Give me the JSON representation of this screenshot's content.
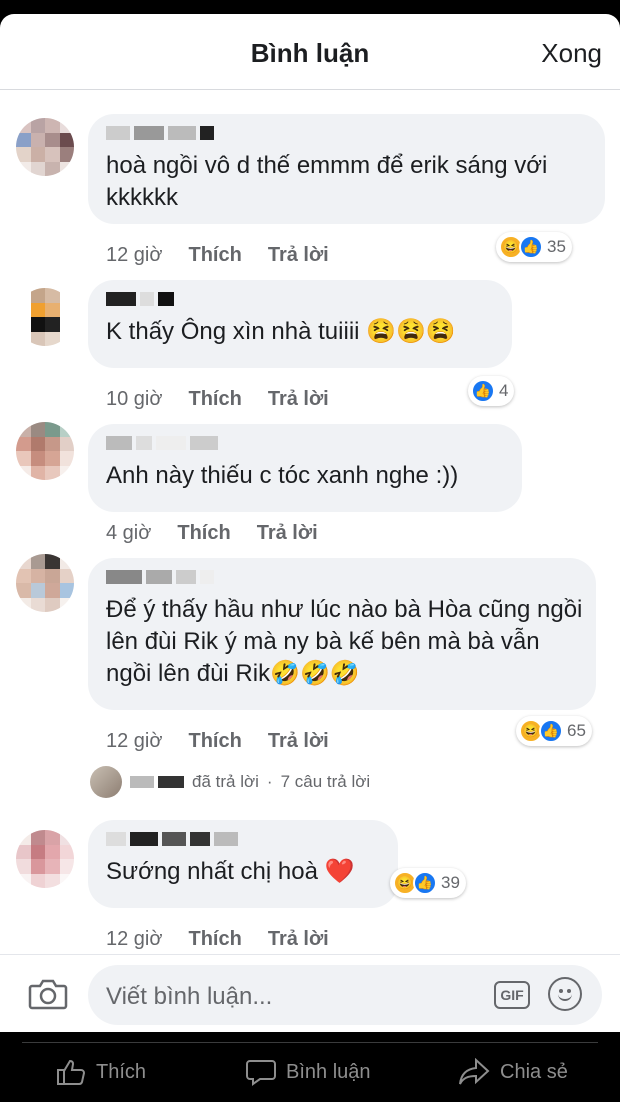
{
  "header": {
    "title": "Bình luận",
    "done_label": "Xong"
  },
  "comments": [
    {
      "text": "hoà ngồi vô d thế emmm để erik sáng với kkkkkk",
      "time": "12 giờ",
      "like_label": "Thích",
      "reply_label": "Trả lời",
      "reaction_count": "35"
    },
    {
      "text": "K thấy Ông xìn nhà tuiiii 😫😫😫",
      "time": "10 giờ",
      "like_label": "Thích",
      "reply_label": "Trả lời",
      "reaction_count": "4"
    },
    {
      "text": "Anh này thiếu c tóc xanh nghe :))",
      "time": "4 giờ",
      "like_label": "Thích",
      "reply_label": "Trả lời"
    },
    {
      "text": "Để ý thấy hầu như lúc nào bà Hòa cũng ngồi lên đùi Rik ý mà ny bà kế bên mà bà vẫn ngồi lên đùi Rik🤣🤣🤣",
      "time": "12 giờ",
      "like_label": "Thích",
      "reply_label": "Trả lời",
      "reaction_count": "65"
    },
    {
      "text": "Sướng nhất chị hoà ❤️",
      "time": "12 giờ",
      "like_label": "Thích",
      "reply_label": "Trả lời",
      "reaction_count": "39"
    }
  ],
  "reply_summary": {
    "replied_label": "đã trả lời",
    "separator": "·",
    "count_label": "7 câu trả lời"
  },
  "composer": {
    "placeholder": "Viết bình luận...",
    "gif_label": "GIF"
  },
  "footer": {
    "like_label": "Thích",
    "comment_label": "Bình luận",
    "share_label": "Chia sẻ"
  },
  "icons": [
    "camera-icon",
    "gif-icon",
    "emoji-icon",
    "thumbs-up-icon",
    "comment-icon",
    "share-icon",
    "haha-reaction-icon",
    "like-reaction-icon"
  ],
  "colors": {
    "accent": "#1877f2",
    "bubble": "#f0f2f5",
    "text": "#1c1e21",
    "muted": "#65676b"
  }
}
